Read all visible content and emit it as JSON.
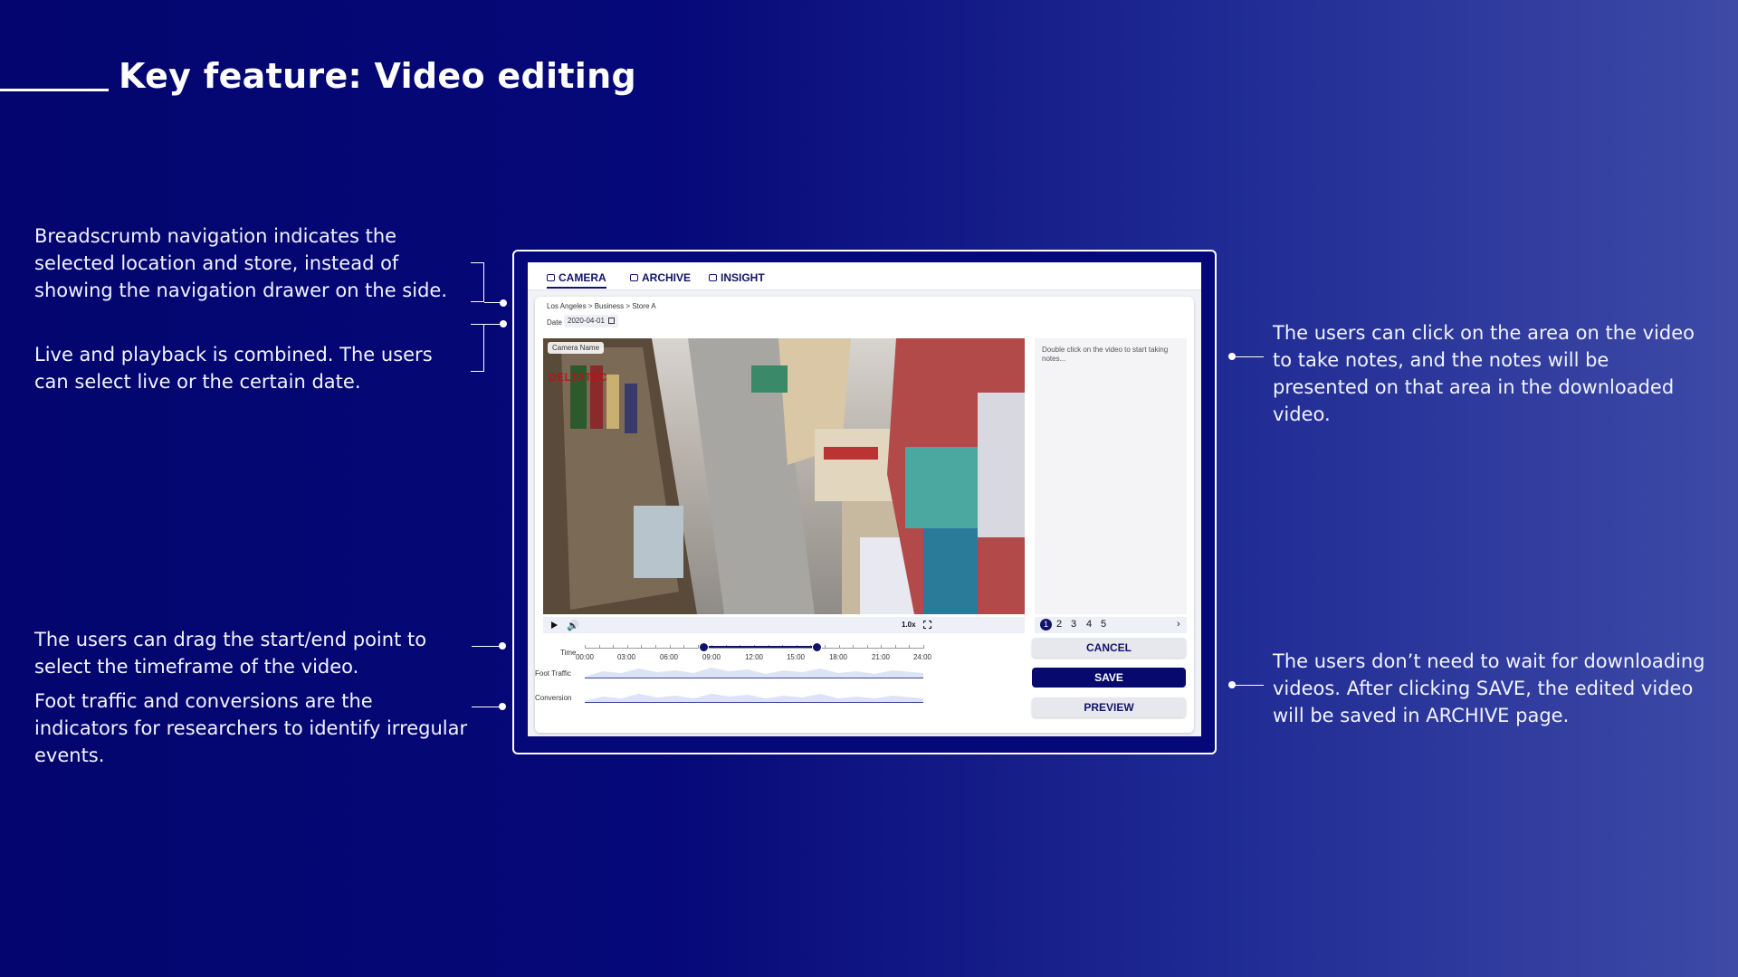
{
  "page": {
    "title": "Key feature: Video editing"
  },
  "notes": {
    "breadcrumb": "Breadscrumb navigation indicates the selected location and store, instead of showing the navigation drawer on the side.",
    "live": "Live and playback is combined. The users can select live or the certain date.",
    "timeframe": "The users can drag the start/end point to select the timeframe of the video.",
    "indicators": "Foot traffic and conversions are the indicators for researchers to identify irregular events.",
    "take_notes": "The users can click on the area on the video to take notes, and the notes will be presented on that area in the downloaded video.",
    "save": "The users don’t need to wait for downloading videos. After clicking SAVE, the edited video will be saved in ARCHIVE page."
  },
  "app": {
    "tabs": [
      {
        "label": "CAMERA",
        "icon": "camera-icon",
        "active": true
      },
      {
        "label": "ARCHIVE",
        "icon": "folder-icon",
        "active": false
      },
      {
        "label": "INSIGHT",
        "icon": "insight-icon",
        "active": false
      }
    ],
    "breadcrumb": "Los Angeles > Business > Store A",
    "date_label": "Date",
    "date_value": "2020-04-01",
    "camera_name": "Camera Name",
    "watermark": "DELTATEC",
    "notes_placeholder": "Double click on the video to start taking notes...",
    "speed": "1.0x",
    "pages": [
      "1",
      "2",
      "3",
      "4",
      "5"
    ],
    "pager_next": "›",
    "time_label": "Time",
    "times": [
      "00:00",
      "03:00",
      "06:00",
      "09:00",
      "12:00",
      "15:00",
      "18:00",
      "21:00",
      "24:00"
    ],
    "foot_traffic_label": "Foot Traffic",
    "conversion_label": "Conversion",
    "buttons": {
      "cancel": "CANCEL",
      "save": "SAVE",
      "preview": "PREVIEW"
    },
    "colors": {
      "primary": "#08096e",
      "background": "#050878"
    }
  }
}
